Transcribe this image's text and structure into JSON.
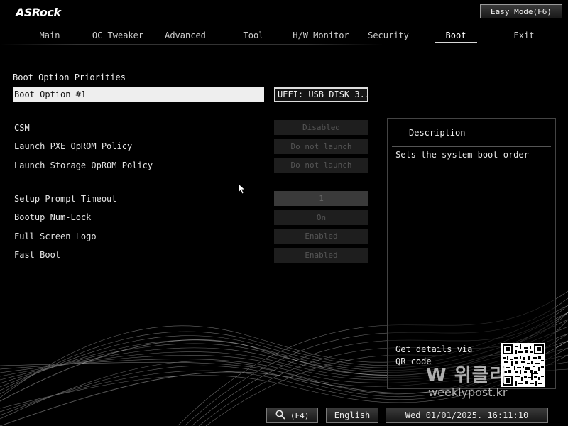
{
  "header": {
    "logo": "ASRock",
    "easy_mode": "Easy Mode(F6)"
  },
  "tabs": [
    {
      "label": "Main"
    },
    {
      "label": "OC Tweaker"
    },
    {
      "label": "Advanced"
    },
    {
      "label": "Tool"
    },
    {
      "label": "H/W Monitor"
    },
    {
      "label": "Security"
    },
    {
      "label": "Boot",
      "active": true
    },
    {
      "label": "Exit"
    }
  ],
  "boot": {
    "section_title": "Boot Option Priorities",
    "option1_label": "Boot Option #1",
    "option1_value": "UEFI:  USB DISK 3...",
    "csm_label": "CSM",
    "csm_value": "Disabled",
    "pxe_label": "Launch PXE OpROM Policy",
    "pxe_value": "Do not launch",
    "storage_label": "Launch Storage OpROM Policy",
    "storage_value": "Do not launch",
    "timeout_label": "Setup Prompt Timeout",
    "timeout_value": "1",
    "numlock_label": "Bootup Num-Lock",
    "numlock_value": "On",
    "logo_label": "Full Screen Logo",
    "logo_value": "Enabled",
    "fastboot_label": "Fast Boot",
    "fastboot_value": "Enabled"
  },
  "description": {
    "title": "Description",
    "text": "Sets the system boot order",
    "qr_text": "Get details via QR code"
  },
  "watermark": {
    "main": "W 위클리",
    "sub": "weeklypost.kr"
  },
  "footer": {
    "search_key": "(F4)",
    "language": "English",
    "datetime": "Wed 01/01/2025. 16:11:10"
  },
  "colors": {
    "background": "#000000",
    "highlight": "#eeeeee",
    "text": "#e6e6e6"
  }
}
